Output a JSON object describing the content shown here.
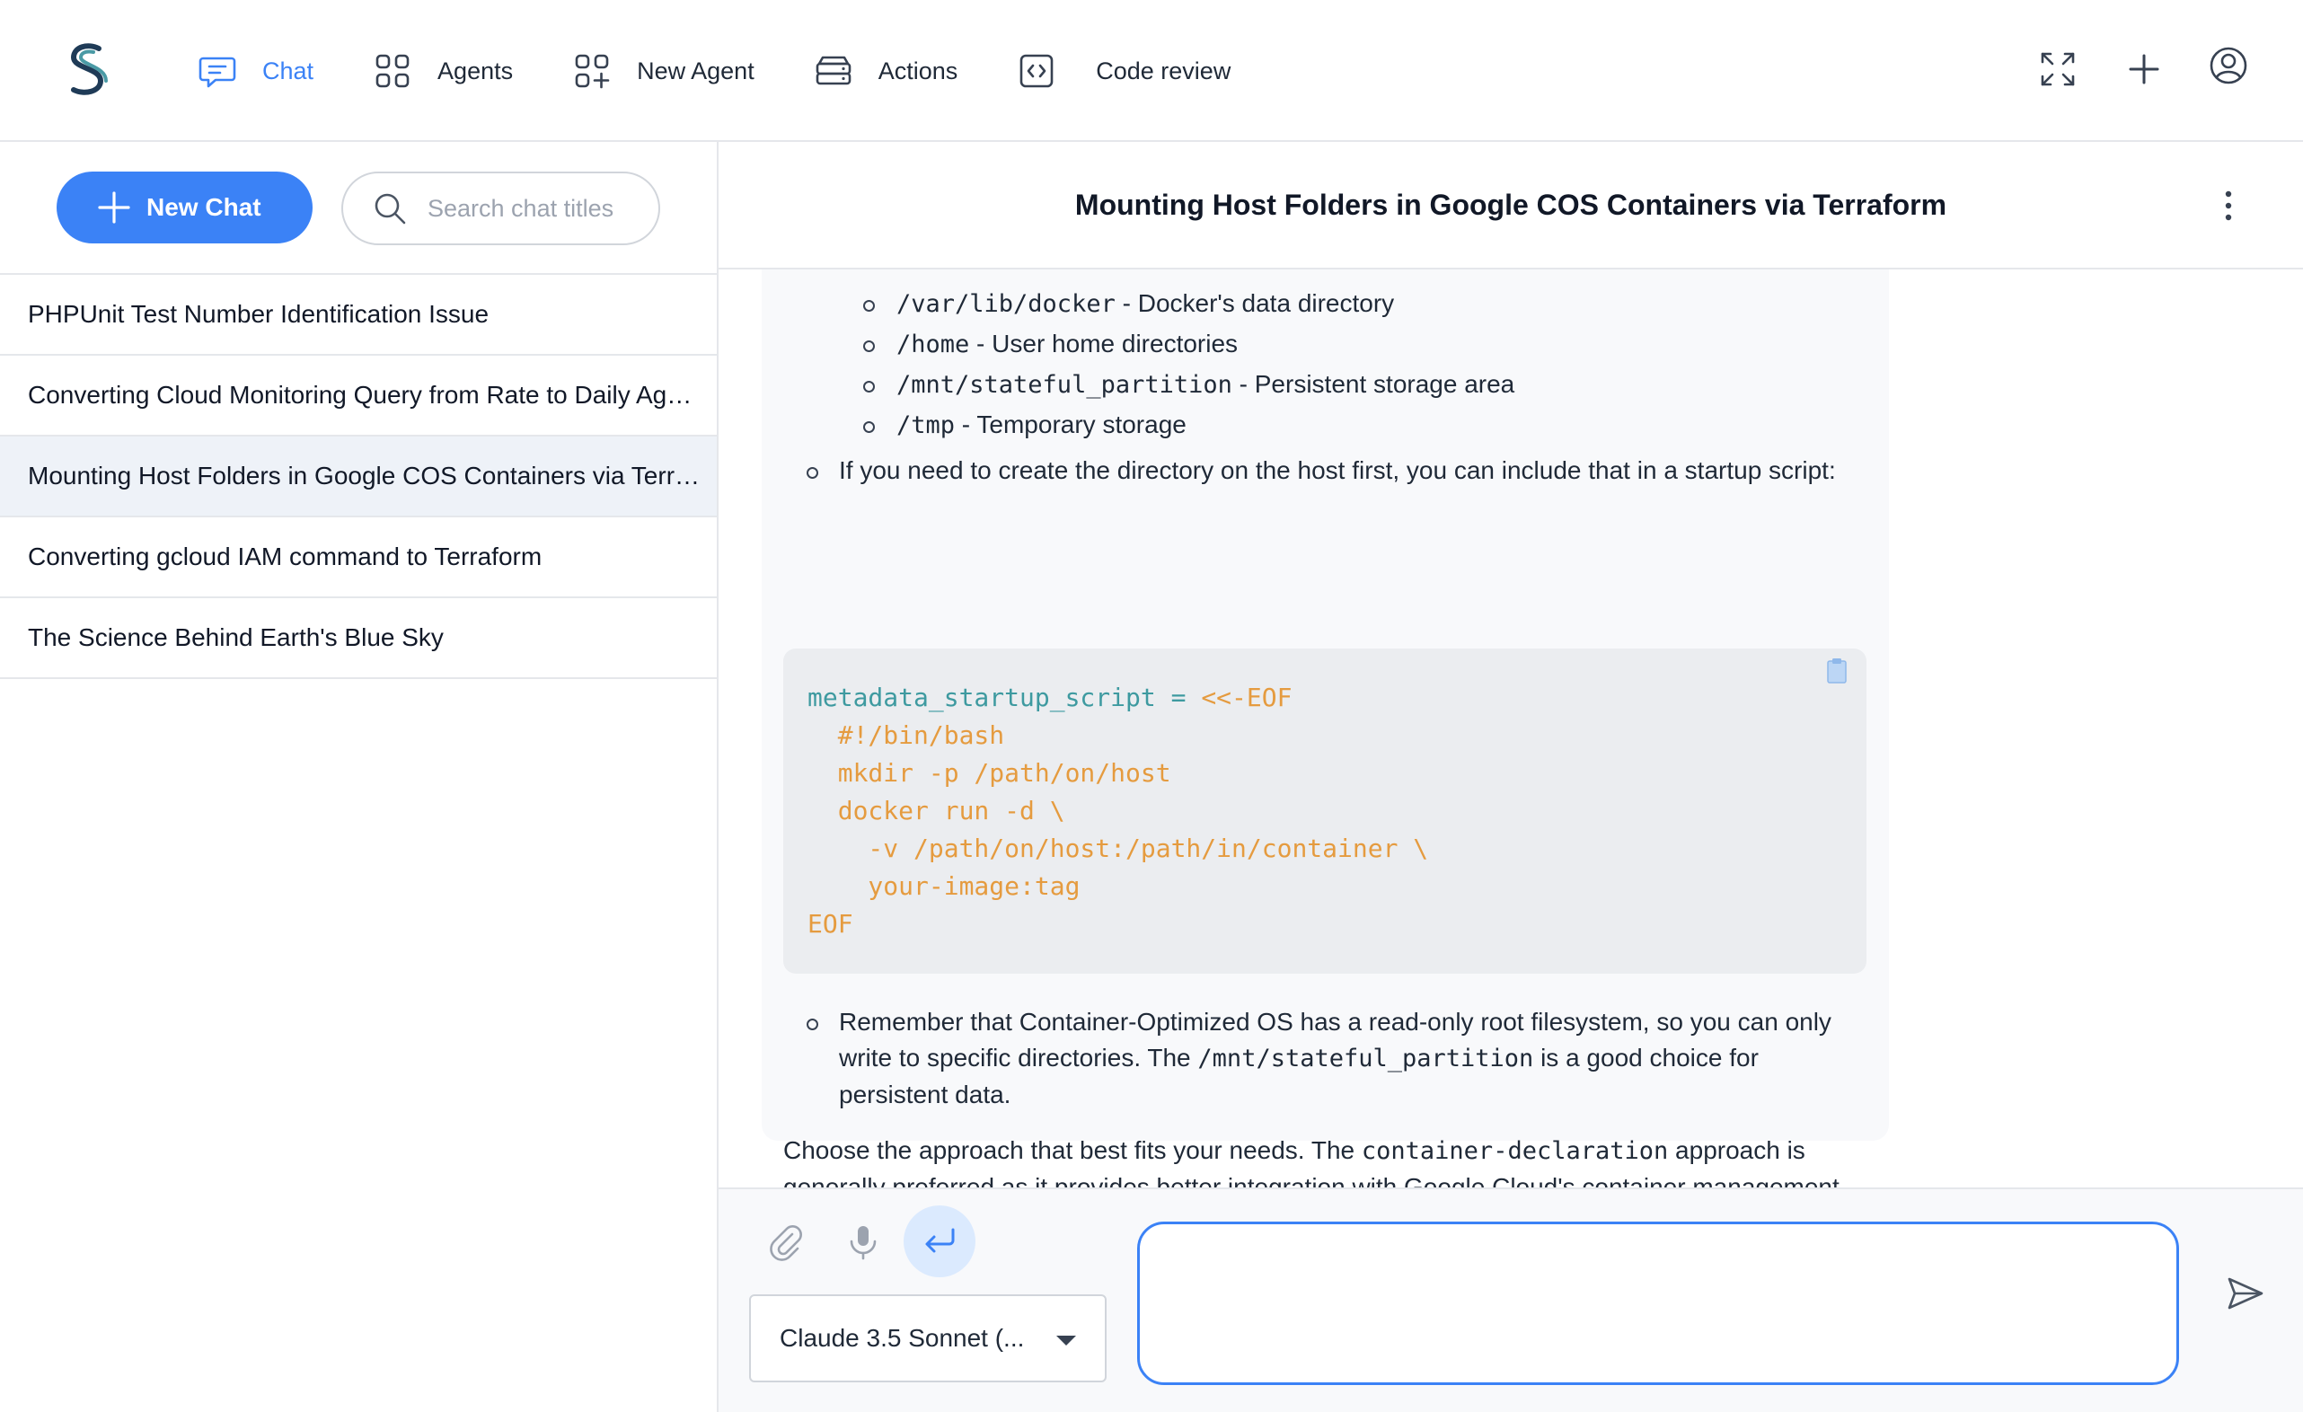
{
  "nav": {
    "items": [
      {
        "label": "Chat",
        "icon": "chat-bubble-icon",
        "active": true
      },
      {
        "label": "Agents",
        "icon": "grid-icon"
      },
      {
        "label": "New Agent",
        "icon": "grid-plus-icon"
      },
      {
        "label": "Actions",
        "icon": "server-stack-icon"
      },
      {
        "label": "Code review",
        "icon": "code-brackets-icon"
      }
    ],
    "right_icons": [
      "expand-icon",
      "plus-icon",
      "account-icon"
    ]
  },
  "sidebar": {
    "new_chat_label": "New Chat",
    "search_placeholder": "Search chat titles",
    "chats": [
      {
        "title": "PHPUnit Test Number Identification Issue"
      },
      {
        "title": "Converting Cloud Monitoring Query from Rate to Daily Aggregation"
      },
      {
        "title": "Mounting Host Folders in Google COS Containers via Terraform",
        "active": true
      },
      {
        "title": "Converting gcloud IAM command to Terraform"
      },
      {
        "title": "The Science Behind Earth's Blue Sky"
      }
    ]
  },
  "main": {
    "title": "Mounting Host Folders in Google COS Containers via Terraform",
    "message": {
      "sub_items": [
        {
          "code": "/var/lib/docker",
          "text": " - Docker's data directory"
        },
        {
          "code": "/home",
          "text": " - User home directories"
        },
        {
          "code": "/mnt/stateful_partition",
          "text": " - Persistent storage area"
        },
        {
          "code": "/tmp",
          "text": " - Temporary storage"
        }
      ],
      "bullet_1": "If you need to create the directory on the host first, you can include that in a startup script:",
      "code_block": {
        "var": "metadata_startup_script",
        "op": " = ",
        "lines": "<<-EOF\n  #!/bin/bash\n  mkdir -p /path/on/host\n  docker run -d \\\n    -v /path/on/host:/path/in/container \\\n    your-image:tag\nEOF"
      },
      "bullet_2": {
        "before": "Remember that Container-Optimized OS has a read-only root filesystem, so you can only write to specific directories. The ",
        "code": "/mnt/stateful_partition",
        "after": " is a good choice for persistent data."
      },
      "closing": {
        "before": "Choose the approach that best fits your needs. The ",
        "code": "container-declaration",
        "after": " approach is generally preferred as it provides better integration with Google Cloud's container management features and is more declarative."
      }
    }
  },
  "composer": {
    "model": "Claude 3.5 Sonnet (...",
    "input_value": "",
    "icons": [
      "paperclip-icon",
      "microphone-icon",
      "enter-icon",
      "send-icon"
    ]
  },
  "colors": {
    "accent": "#3b82f6",
    "code_orange": "#e59b3f",
    "code_teal": "#3e9aa0"
  }
}
